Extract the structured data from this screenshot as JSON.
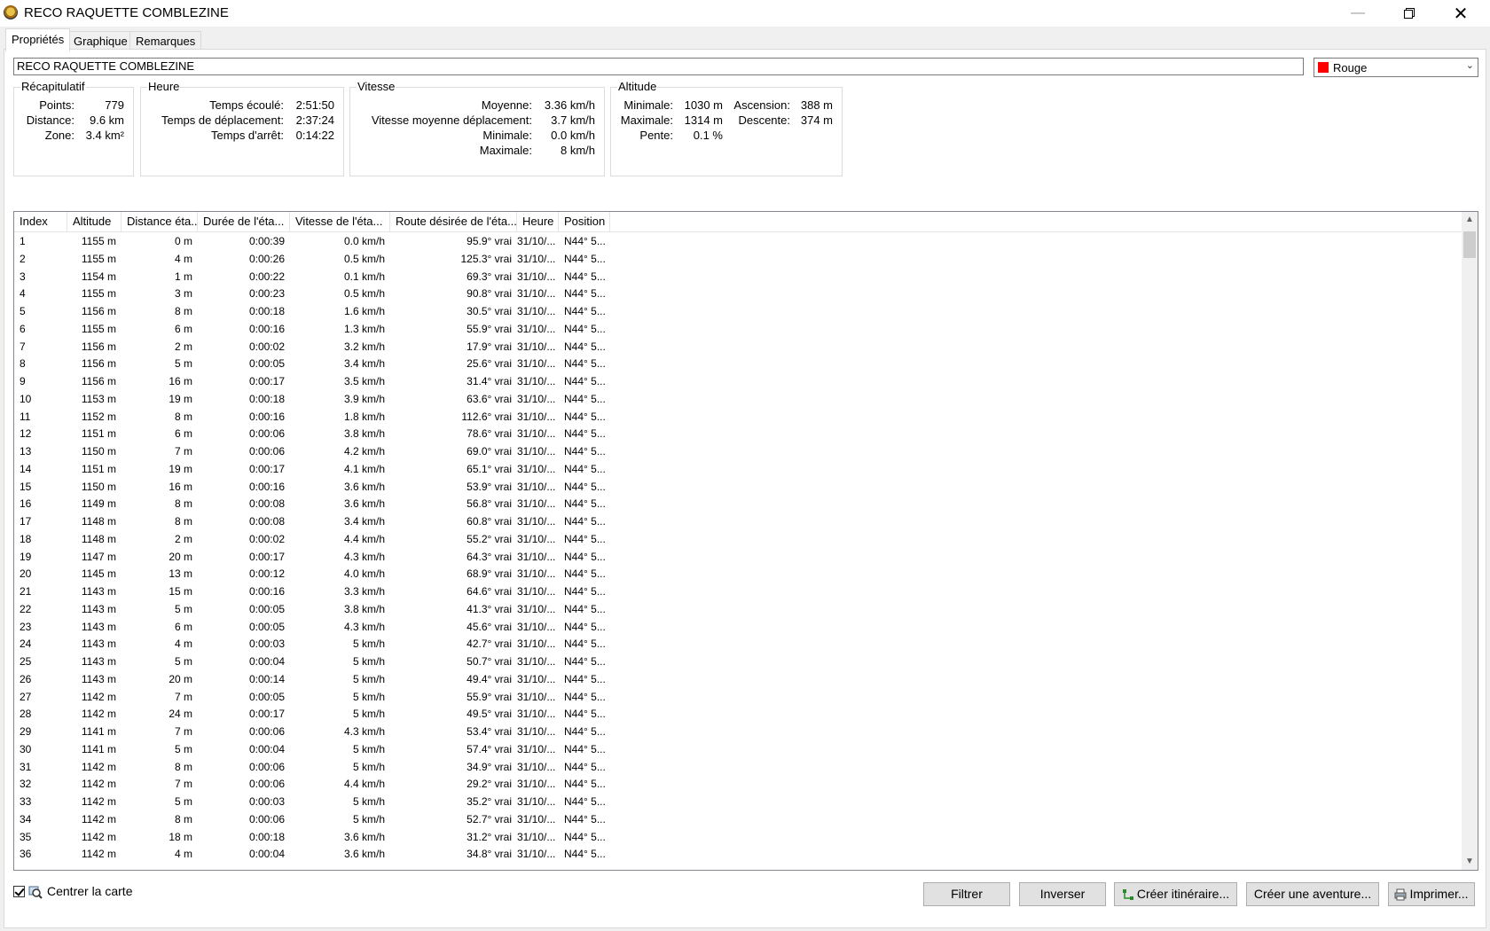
{
  "window": {
    "title": "RECO RAQUETTE COMBLEZINE"
  },
  "tabs": [
    {
      "label": "Propriétés"
    },
    {
      "label": "Graphique"
    },
    {
      "label": "Remarques"
    }
  ],
  "track": {
    "name": "RECO RAQUETTE COMBLEZINE",
    "color_label": "Rouge",
    "color_hex": "#ff0000"
  },
  "summary": {
    "title": "Récapitulatif",
    "points_label": "Points:",
    "points_value": "779",
    "distance_label": "Distance:",
    "distance_value": "9.6 km",
    "zone_label": "Zone:",
    "zone_value": "3.4 km²"
  },
  "time": {
    "title": "Heure",
    "elapsed_label": "Temps écoulé:",
    "elapsed_value": "2:51:50",
    "moving_label": "Temps de déplacement:",
    "moving_value": "2:37:24",
    "stopped_label": "Temps d'arrêt:",
    "stopped_value": "0:14:22"
  },
  "speed": {
    "title": "Vitesse",
    "avg_label": "Moyenne:",
    "avg_value": "3.36 km/h",
    "moving_avg_label": "Vitesse moyenne déplacement:",
    "moving_avg_value": "3.7 km/h",
    "min_label": "Minimale:",
    "min_value": "0.0 km/h",
    "max_label": "Maximale:",
    "max_value": "8 km/h"
  },
  "altitude": {
    "title": "Altitude",
    "min_label": "Minimale:",
    "min_value": "1030 m",
    "max_label": "Maximale:",
    "max_value": "1314 m",
    "slope_label": "Pente:",
    "slope_value": "0.1 %",
    "ascent_label": "Ascension:",
    "ascent_value": "388 m",
    "descent_label": "Descente:",
    "descent_value": "374 m"
  },
  "table": {
    "columns": [
      "Index",
      "Altitude",
      "Distance éta...",
      "Durée de l'éta...",
      "Vitesse de l'éta...",
      "Route désirée de l'éta...",
      "Heure",
      "Position"
    ],
    "rows": [
      [
        "1",
        "1155 m",
        "0 m",
        "0:00:39",
        "0.0 km/h",
        "95.9° vrai",
        "31/10/...",
        "N44° 5..."
      ],
      [
        "2",
        "1155 m",
        "4 m",
        "0:00:26",
        "0.5 km/h",
        "125.3° vrai",
        "31/10/...",
        "N44° 5..."
      ],
      [
        "3",
        "1154 m",
        "1 m",
        "0:00:22",
        "0.1 km/h",
        "69.3° vrai",
        "31/10/...",
        "N44° 5..."
      ],
      [
        "4",
        "1155 m",
        "3 m",
        "0:00:23",
        "0.5 km/h",
        "90.8° vrai",
        "31/10/...",
        "N44° 5..."
      ],
      [
        "5",
        "1156 m",
        "8 m",
        "0:00:18",
        "1.6 km/h",
        "30.5° vrai",
        "31/10/...",
        "N44° 5..."
      ],
      [
        "6",
        "1155 m",
        "6 m",
        "0:00:16",
        "1.3 km/h",
        "55.9° vrai",
        "31/10/...",
        "N44° 5..."
      ],
      [
        "7",
        "1156 m",
        "2 m",
        "0:00:02",
        "3.2 km/h",
        "17.9° vrai",
        "31/10/...",
        "N44° 5..."
      ],
      [
        "8",
        "1156 m",
        "5 m",
        "0:00:05",
        "3.4 km/h",
        "25.6° vrai",
        "31/10/...",
        "N44° 5..."
      ],
      [
        "9",
        "1156 m",
        "16 m",
        "0:00:17",
        "3.5 km/h",
        "31.4° vrai",
        "31/10/...",
        "N44° 5..."
      ],
      [
        "10",
        "1153 m",
        "19 m",
        "0:00:18",
        "3.9 km/h",
        "63.6° vrai",
        "31/10/...",
        "N44° 5..."
      ],
      [
        "11",
        "1152 m",
        "8 m",
        "0:00:16",
        "1.8 km/h",
        "112.6° vrai",
        "31/10/...",
        "N44° 5..."
      ],
      [
        "12",
        "1151 m",
        "6 m",
        "0:00:06",
        "3.8 km/h",
        "78.6° vrai",
        "31/10/...",
        "N44° 5..."
      ],
      [
        "13",
        "1150 m",
        "7 m",
        "0:00:06",
        "4.2 km/h",
        "69.0° vrai",
        "31/10/...",
        "N44° 5..."
      ],
      [
        "14",
        "1151 m",
        "19 m",
        "0:00:17",
        "4.1 km/h",
        "65.1° vrai",
        "31/10/...",
        "N44° 5..."
      ],
      [
        "15",
        "1150 m",
        "16 m",
        "0:00:16",
        "3.6 km/h",
        "53.9° vrai",
        "31/10/...",
        "N44° 5..."
      ],
      [
        "16",
        "1149 m",
        "8 m",
        "0:00:08",
        "3.6 km/h",
        "56.8° vrai",
        "31/10/...",
        "N44° 5..."
      ],
      [
        "17",
        "1148 m",
        "8 m",
        "0:00:08",
        "3.4 km/h",
        "60.8° vrai",
        "31/10/...",
        "N44° 5..."
      ],
      [
        "18",
        "1148 m",
        "2 m",
        "0:00:02",
        "4.4 km/h",
        "55.2° vrai",
        "31/10/...",
        "N44° 5..."
      ],
      [
        "19",
        "1147 m",
        "20 m",
        "0:00:17",
        "4.3 km/h",
        "64.3° vrai",
        "31/10/...",
        "N44° 5..."
      ],
      [
        "20",
        "1145 m",
        "13 m",
        "0:00:12",
        "4.0 km/h",
        "68.9° vrai",
        "31/10/...",
        "N44° 5..."
      ],
      [
        "21",
        "1143 m",
        "15 m",
        "0:00:16",
        "3.3 km/h",
        "64.6° vrai",
        "31/10/...",
        "N44° 5..."
      ],
      [
        "22",
        "1143 m",
        "5 m",
        "0:00:05",
        "3.8 km/h",
        "41.3° vrai",
        "31/10/...",
        "N44° 5..."
      ],
      [
        "23",
        "1143 m",
        "6 m",
        "0:00:05",
        "4.3 km/h",
        "45.6° vrai",
        "31/10/...",
        "N44° 5..."
      ],
      [
        "24",
        "1143 m",
        "4 m",
        "0:00:03",
        "5 km/h",
        "42.7° vrai",
        "31/10/...",
        "N44° 5..."
      ],
      [
        "25",
        "1143 m",
        "5 m",
        "0:00:04",
        "5 km/h",
        "50.7° vrai",
        "31/10/...",
        "N44° 5..."
      ],
      [
        "26",
        "1143 m",
        "20 m",
        "0:00:14",
        "5 km/h",
        "49.4° vrai",
        "31/10/...",
        "N44° 5..."
      ],
      [
        "27",
        "1142 m",
        "7 m",
        "0:00:05",
        "5 km/h",
        "55.9° vrai",
        "31/10/...",
        "N44° 5..."
      ],
      [
        "28",
        "1142 m",
        "24 m",
        "0:00:17",
        "5 km/h",
        "49.5° vrai",
        "31/10/...",
        "N44° 5..."
      ],
      [
        "29",
        "1141 m",
        "7 m",
        "0:00:06",
        "4.3 km/h",
        "53.4° vrai",
        "31/10/...",
        "N44° 5..."
      ],
      [
        "30",
        "1141 m",
        "5 m",
        "0:00:04",
        "5 km/h",
        "57.4° vrai",
        "31/10/...",
        "N44° 5..."
      ],
      [
        "31",
        "1142 m",
        "8 m",
        "0:00:06",
        "5 km/h",
        "34.9° vrai",
        "31/10/...",
        "N44° 5..."
      ],
      [
        "32",
        "1142 m",
        "7 m",
        "0:00:06",
        "4.4 km/h",
        "29.2° vrai",
        "31/10/...",
        "N44° 5..."
      ],
      [
        "33",
        "1142 m",
        "5 m",
        "0:00:03",
        "5 km/h",
        "35.2° vrai",
        "31/10/...",
        "N44° 5..."
      ],
      [
        "34",
        "1142 m",
        "8 m",
        "0:00:06",
        "5 km/h",
        "52.7° vrai",
        "31/10/...",
        "N44° 5..."
      ],
      [
        "35",
        "1142 m",
        "18 m",
        "0:00:18",
        "3.6 km/h",
        "31.2° vrai",
        "31/10/...",
        "N44° 5..."
      ],
      [
        "36",
        "1142 m",
        "4 m",
        "0:00:04",
        "3.6 km/h",
        "34.8° vrai",
        "31/10/...",
        "N44° 5..."
      ]
    ]
  },
  "footer": {
    "center_map_label": "Centrer la carte",
    "center_map_checked": true,
    "buttons": {
      "filter": "Filtrer",
      "invert": "Inverser",
      "create_route": "Créer itinéraire...",
      "create_adventure": "Créer une aventure...",
      "print": "Imprimer..."
    }
  }
}
